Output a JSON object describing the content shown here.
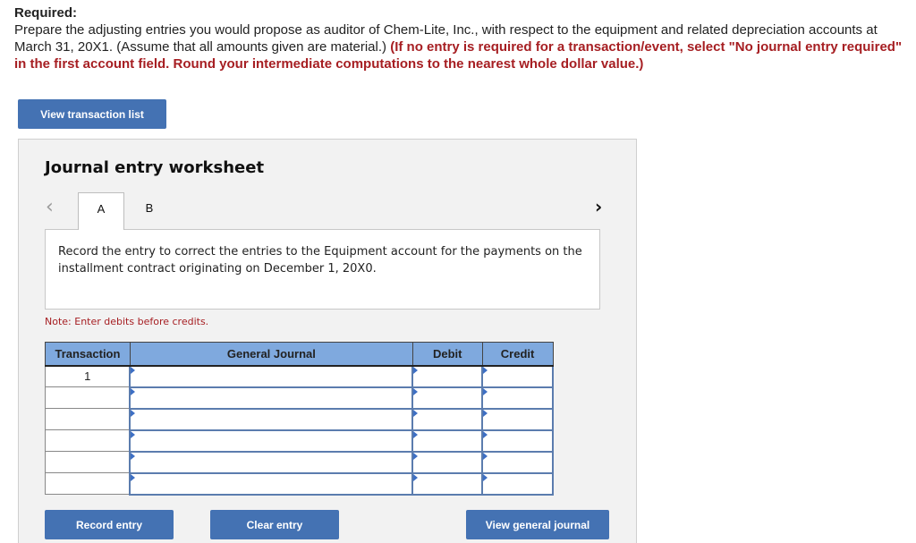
{
  "instructions": {
    "label": "Required:",
    "text": "Prepare the adjusting entries you would propose as auditor of Chem-Lite, Inc., with respect to the equipment and related depreciation accounts at March 31, 20X1. (Assume that all amounts given are material.) ",
    "emphasis": "(If no entry is required for a transaction/event, select \"No journal entry required\" in the first account field. Round your intermediate computations to the nearest whole dollar value.)"
  },
  "buttons": {
    "view_transaction_list": "View transaction list",
    "record_entry": "Record entry",
    "clear_entry": "Clear entry",
    "view_general_journal": "View general journal"
  },
  "worksheet": {
    "title": "Journal entry worksheet",
    "prev_icon": "‹",
    "next_icon": "›",
    "tabs": [
      {
        "label": "A",
        "active": true
      },
      {
        "label": "B",
        "active": false
      }
    ],
    "description": "Record the entry to correct the entries to the Equipment account for the payments on the installment contract originating on December 1, 20X0.",
    "note": "Note: Enter debits before credits."
  },
  "journal": {
    "columns": [
      "Transaction",
      "General Journal",
      "Debit",
      "Credit"
    ],
    "rows": [
      {
        "transaction": "1",
        "account": "",
        "debit": "",
        "credit": ""
      },
      {
        "transaction": "",
        "account": "",
        "debit": "",
        "credit": ""
      },
      {
        "transaction": "",
        "account": "",
        "debit": "",
        "credit": ""
      },
      {
        "transaction": "",
        "account": "",
        "debit": "",
        "credit": ""
      },
      {
        "transaction": "",
        "account": "",
        "debit": "",
        "credit": ""
      },
      {
        "transaction": "",
        "account": "",
        "debit": "",
        "credit": ""
      }
    ]
  },
  "colors": {
    "button_blue": "#4472b3",
    "header_blue": "#7fa9de",
    "emphasis_red": "#a61e22"
  }
}
